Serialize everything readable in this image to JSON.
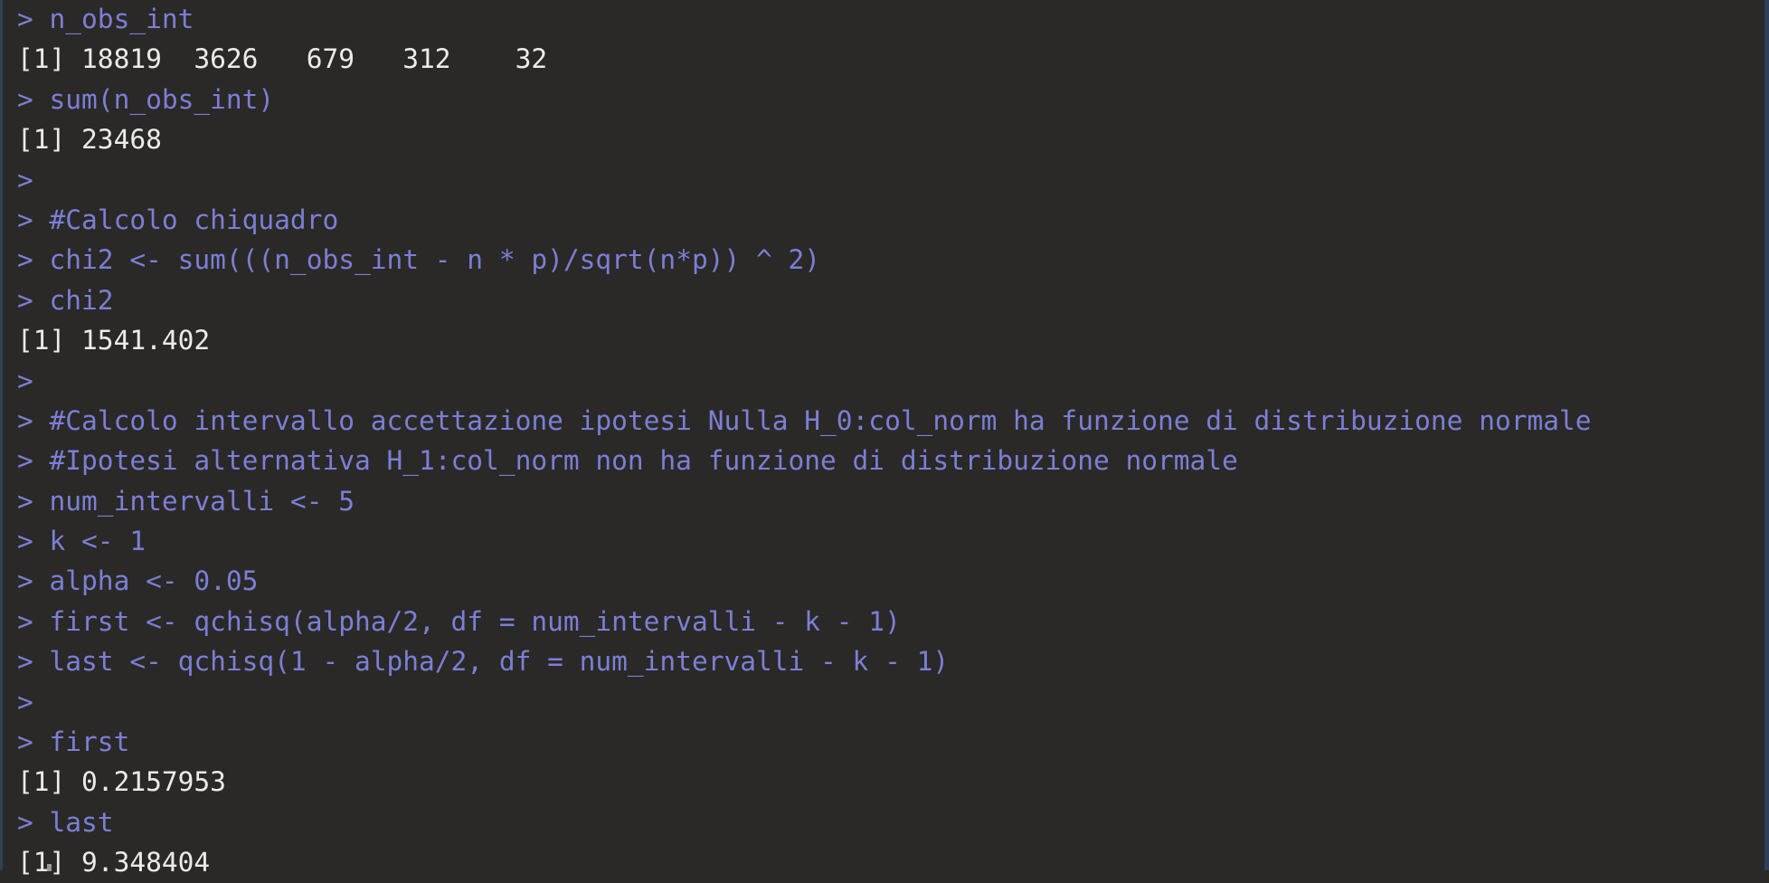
{
  "colors": {
    "background": "#2a2927",
    "input": "#7b7fd6",
    "output": "#ebebeb"
  },
  "lines": [
    {
      "type": "in",
      "text": "> n_obs_int"
    },
    {
      "type": "out",
      "text": "[1] 18819  3626   679   312    32"
    },
    {
      "type": "in",
      "text": "> sum(n_obs_int)"
    },
    {
      "type": "out",
      "text": "[1] 23468"
    },
    {
      "type": "in",
      "text": ">"
    },
    {
      "type": "in",
      "text": "> #Calcolo chiquadro"
    },
    {
      "type": "in",
      "text": "> chi2 <- sum(((n_obs_int - n * p)/sqrt(n*p)) ^ 2)"
    },
    {
      "type": "in",
      "text": "> chi2"
    },
    {
      "type": "out",
      "text": "[1] 1541.402"
    },
    {
      "type": "in",
      "text": ">"
    },
    {
      "type": "in",
      "text": "> #Calcolo intervallo accettazione ipotesi Nulla H_0:col_norm ha funzione di distribuzione normale"
    },
    {
      "type": "in",
      "text": "> #Ipotesi alternativa H_1:col_norm non ha funzione di distribuzione normale"
    },
    {
      "type": "in",
      "text": "> num_intervalli <- 5"
    },
    {
      "type": "in",
      "text": "> k <- 1"
    },
    {
      "type": "in",
      "text": "> alpha <- 0.05"
    },
    {
      "type": "in",
      "text": "> first <- qchisq(alpha/2, df = num_intervalli - k - 1)"
    },
    {
      "type": "in",
      "text": "> last <- qchisq(1 - alpha/2, df = num_intervalli - k - 1)"
    },
    {
      "type": "in",
      "text": ">"
    },
    {
      "type": "in",
      "text": "> first"
    },
    {
      "type": "out",
      "text": "[1] 0.2157953"
    },
    {
      "type": "in",
      "text": "> last"
    },
    {
      "type": "out",
      "text": "[1] 9.348404"
    }
  ]
}
